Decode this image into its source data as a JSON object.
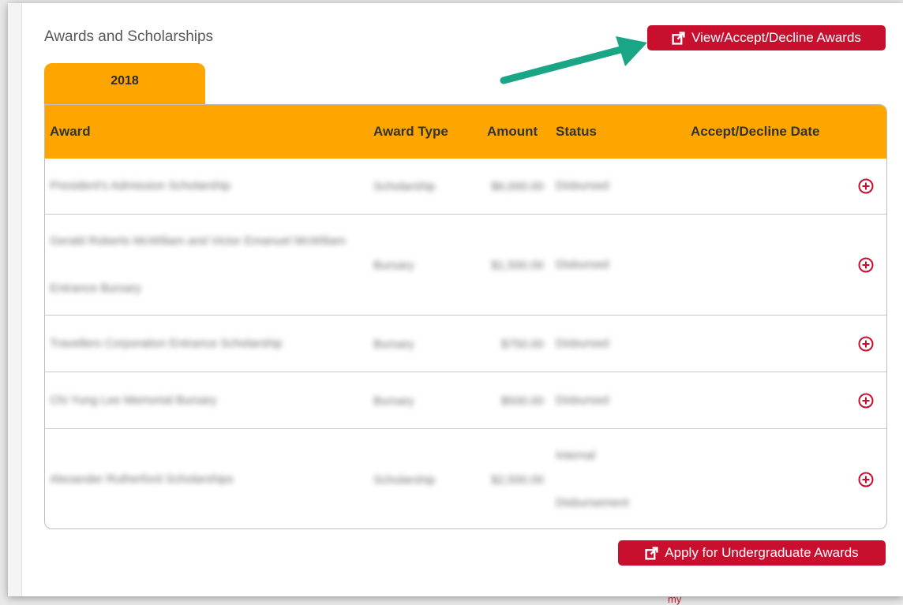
{
  "section": {
    "title": "Awards and Scholarships"
  },
  "buttons": {
    "view_accept_decline": "View/Accept/Decline Awards",
    "apply_undergrad": "Apply for Undergraduate Awards"
  },
  "tabs": [
    {
      "label": "2018",
      "selected": true
    }
  ],
  "table": {
    "headers": {
      "award": "Award",
      "award_type": "Award Type",
      "amount": "Amount",
      "status": "Status",
      "accept_decline_date": "Accept/Decline Date"
    },
    "rows": [
      {
        "award": "President's Admission Scholarship",
        "type": "Scholarship",
        "amount": "$6,000.00",
        "status": "Disbursed"
      },
      {
        "award": "Gerald Roberts McWiliam and Victor Emanuel McWiliam Entrance Bursary",
        "type": "Bursary",
        "amount": "$1,500.00",
        "status": "Disbursed"
      },
      {
        "award": "Travellers Corporation Entrance Scholarship",
        "type": "Bursary",
        "amount": "$750.00",
        "status": "Disbursed"
      },
      {
        "award": "Chi Yung Lee Memorial Bursary",
        "type": "Bursary",
        "amount": "$500.00",
        "status": "Disbursed"
      },
      {
        "award": "Alexander Rutherford Scholarships",
        "type": "Scholarship",
        "amount": "$2,500.00",
        "status": "Internal Disbursement"
      }
    ]
  },
  "footer": {
    "partial_text": "my"
  },
  "colors": {
    "accent_orange": "#ffa500",
    "button_red": "#c8102e",
    "arrow_green": "#1aa587"
  }
}
